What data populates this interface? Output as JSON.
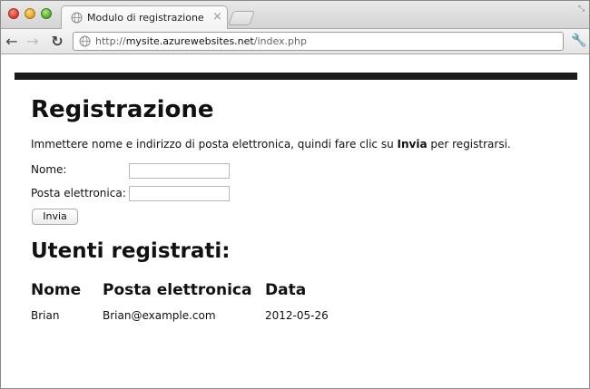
{
  "browser": {
    "tab_title": "Modulo di registrazione",
    "tab_close": "×",
    "url_prefix": "http://",
    "url_domain": "mysite.azurewebsites.net",
    "url_path": "/index.php",
    "icons": {
      "back": "back-arrow-icon",
      "forward": "forward-arrow-icon",
      "reload": "reload-icon",
      "wrench": "wrench-icon"
    }
  },
  "page": {
    "title": "Registrazione",
    "intro_before": "Immettere nome e indirizzo di posta elettronica, quindi fare clic su ",
    "intro_bold": "Invia",
    "intro_after": " per registrarsi.",
    "form": {
      "name_label": "Nome:",
      "name_value": "",
      "email_label": "Posta elettronica:",
      "email_value": "",
      "submit_label": "Invia"
    },
    "users_heading": "Utenti registrati:",
    "table": {
      "headers": [
        "Nome",
        "Posta elettronica",
        "Data"
      ],
      "rows": [
        [
          "Brian",
          "Brian@example.com",
          "2012-05-26"
        ]
      ]
    }
  }
}
